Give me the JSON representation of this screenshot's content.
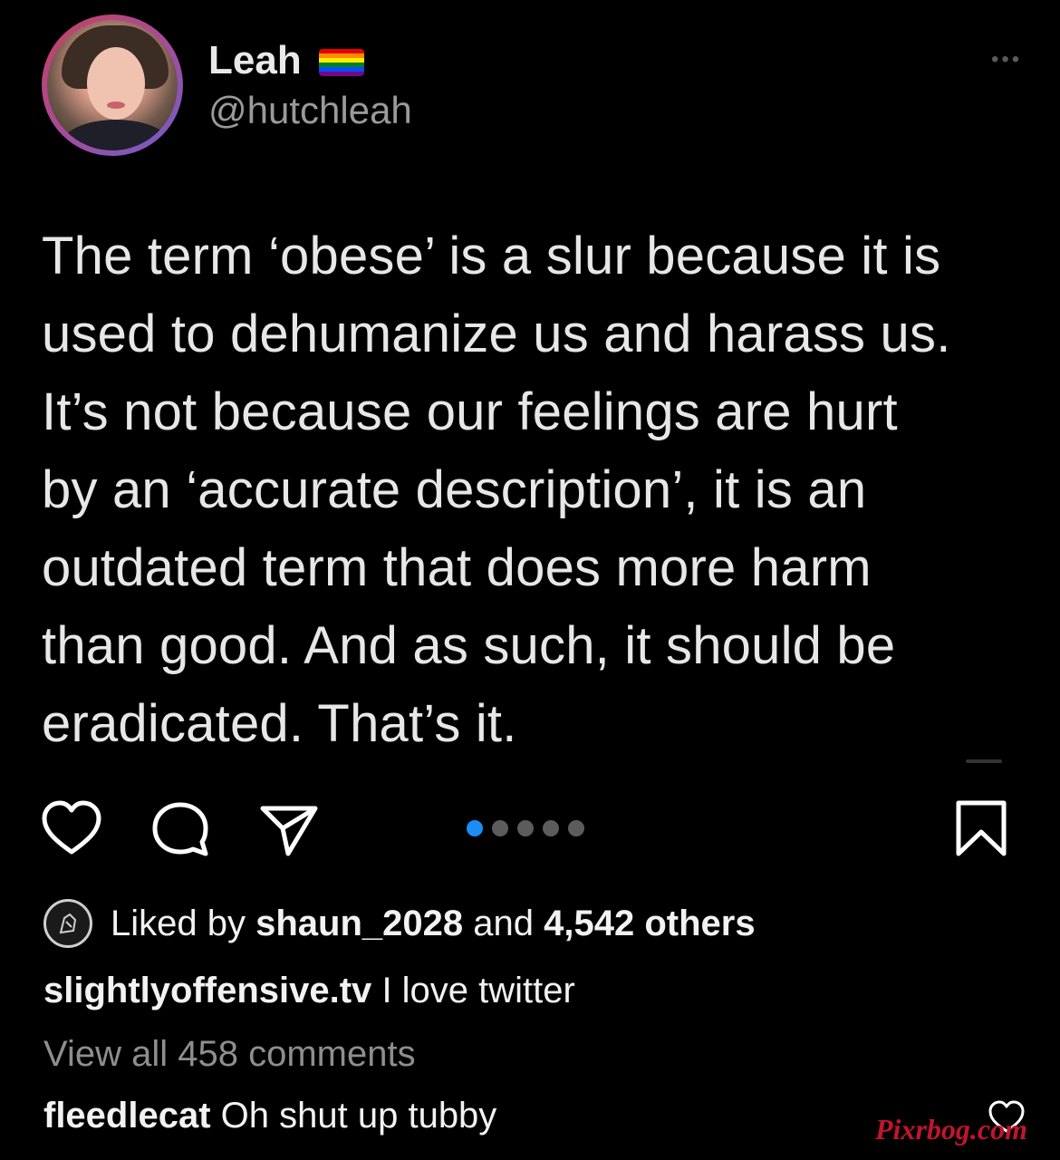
{
  "tweet": {
    "display_name": "Leah",
    "handle": "@hutchleah",
    "more_icon": "ellipsis-icon",
    "pride_flag_colors": [
      "#e40303",
      "#ff8c00",
      "#ffed00",
      "#008026",
      "#004dff",
      "#750787"
    ],
    "text_lines": [
      "The term ‘obese’ is a slur because it is",
      "used to dehumanize us and harass us.",
      "It’s not because our feelings are hurt",
      "by an ‘accurate description’, it is an",
      "outdated term that does more harm",
      "than good. And as such, it should be",
      "eradicated. That’s it."
    ]
  },
  "actions": {
    "like_icon": "heart-icon",
    "comment_icon": "comment-bubble-icon",
    "share_icon": "paper-plane-icon",
    "save_icon": "bookmark-icon",
    "carousel": {
      "total": 5,
      "active_index": 0,
      "active_color": "#1a8ef5"
    }
  },
  "likes": {
    "prefix": "Liked by",
    "user": "shaun_2028",
    "middle": "and",
    "count_text": "4,542 others"
  },
  "caption": {
    "username": "slightlyoffensive.tv",
    "text": "I love twitter"
  },
  "view_comments": "View all 458 comments",
  "top_comment": {
    "username": "fleedlecat",
    "text": "Oh shut up tubby"
  },
  "watermark": "Pixrbog.com"
}
